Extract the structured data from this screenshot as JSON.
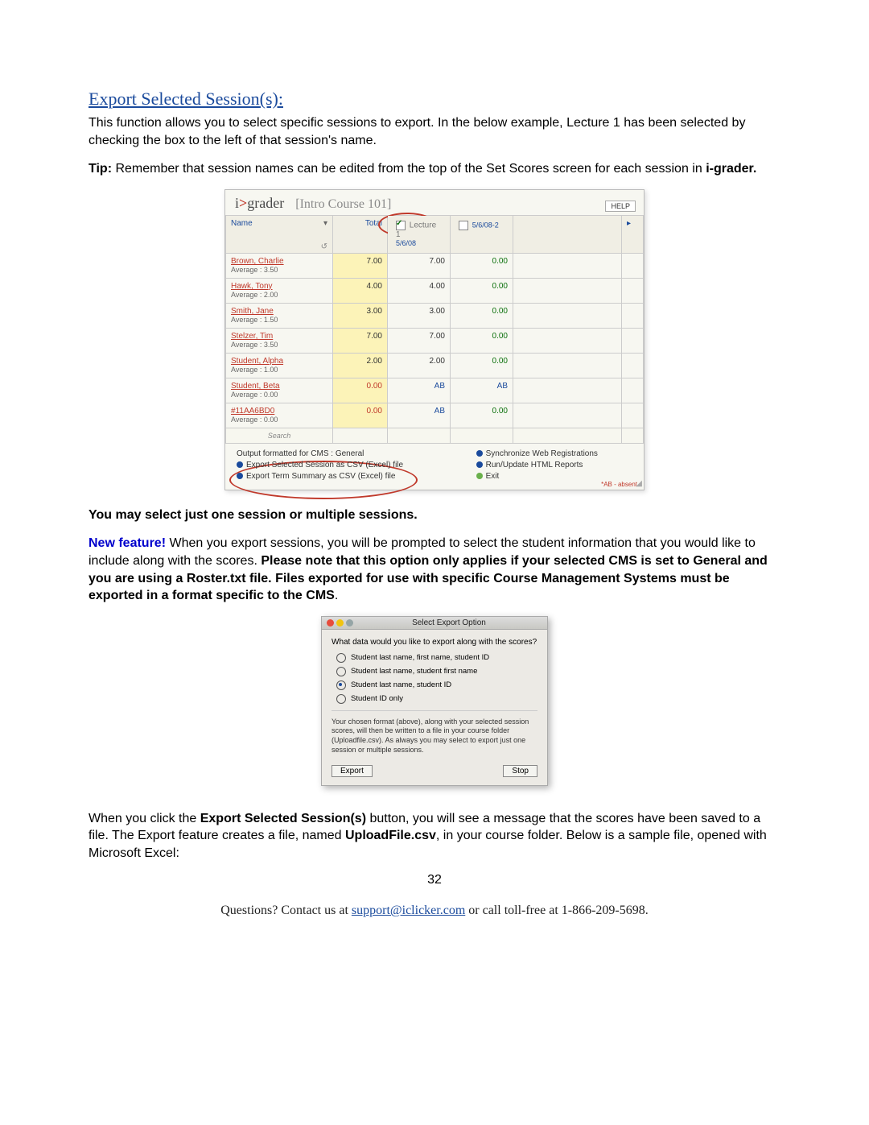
{
  "doc": {
    "section_title": "Export Selected Session(s):",
    "para1": "This function allows you to select specific sessions to export. In the below example, Lecture 1 has been selected by checking the box to the left of that session's name.",
    "tip_label": "Tip:",
    "tip_text": " Remember that session names can be edited from the top of the Set Scores screen for each session in ",
    "tip_bold2": "i-grader.",
    "select_line": "You may select just one session or multiple sessions.",
    "nf_label": "New feature!",
    "nf_text1": " When you export sessions, you will be prompted to select the student information that you would like to include along with the scores.  ",
    "nf_bold": "Please note that this option only applies if your selected CMS is set to General and you are using a Roster.txt file. Files exported for use with specific Course Management Systems must be exported in a format specific to the CMS",
    "nf_period": ".",
    "after_dialog_1a": "When you click the ",
    "after_dialog_1b": "Export Selected Session(s)",
    "after_dialog_1c": " button, you will see a message that the scores have been saved to a file.  The Export feature creates a file, named ",
    "after_dialog_1d": "UploadFile.csv",
    "after_dialog_1e": ", in your course folder. Below is a sample file, opened with Microsoft Excel:",
    "page_num": "32",
    "footer_a": "Questions? Contact us at ",
    "footer_email": "support@iclicker.com",
    "footer_b": " or call toll-free at 1-866-209-5698."
  },
  "igrader": {
    "logo_prefix": "i",
    "logo_dot": ">",
    "logo_suffix": "grader",
    "course": "[Intro Course 101]",
    "help": "HELP",
    "headers": {
      "name": "Name",
      "total": "Total",
      "s1_label": "Lecture 1",
      "s1_date": "5/6/08",
      "s2_label": "5/6/08-2"
    },
    "rows": [
      {
        "name": "Brown, Charlie",
        "avg": "Average : 3.50",
        "t": "7.00",
        "s1": "7.00",
        "s2": "0.00"
      },
      {
        "name": "Hawk, Tony",
        "avg": "Average : 2.00",
        "t": "4.00",
        "s1": "4.00",
        "s2": "0.00"
      },
      {
        "name": "Smith, Jane",
        "avg": "Average : 1.50",
        "t": "3.00",
        "s1": "3.00",
        "s2": "0.00"
      },
      {
        "name": "Stelzer, Tim",
        "avg": "Average : 3.50",
        "t": "7.00",
        "s1": "7.00",
        "s2": "0.00"
      },
      {
        "name": "Student, Alpha",
        "avg": "Average : 1.00",
        "t": "2.00",
        "s1": "2.00",
        "s2": "0.00"
      },
      {
        "name": "Student, Beta",
        "avg": "Average : 0.00",
        "t": "0.00",
        "s1": "AB",
        "s2": "AB"
      },
      {
        "name": "#11AA6BD0",
        "avg": "Average : 0.00",
        "t": "0.00",
        "s1": "AB",
        "s2": "0.00"
      }
    ],
    "search": "Search",
    "footer": {
      "cms": "Output formatted for CMS : General",
      "exp_sel": "Export Selected Session as CSV (Excel) file",
      "exp_term": "Export Term Summary as CSV (Excel) file",
      "sync": "Synchronize Web Registrations",
      "run": "Run/Update HTML Reports",
      "exit": "Exit",
      "ab_note": "*AB - absent"
    }
  },
  "dialog": {
    "title": "Select Export Option",
    "question": "What data would you like to export along with the scores?",
    "opt1": "Student last name, first name, student ID",
    "opt2": "Student last name, student first name",
    "opt3": "Student last name, student ID",
    "opt4": "Student ID only",
    "note": "Your chosen format (above), along with your selected session scores, will then be written to a file in your course folder (Uploadfile.csv). As always you may select to export just one session or multiple sessions.",
    "export": "Export",
    "stop": "Stop"
  }
}
